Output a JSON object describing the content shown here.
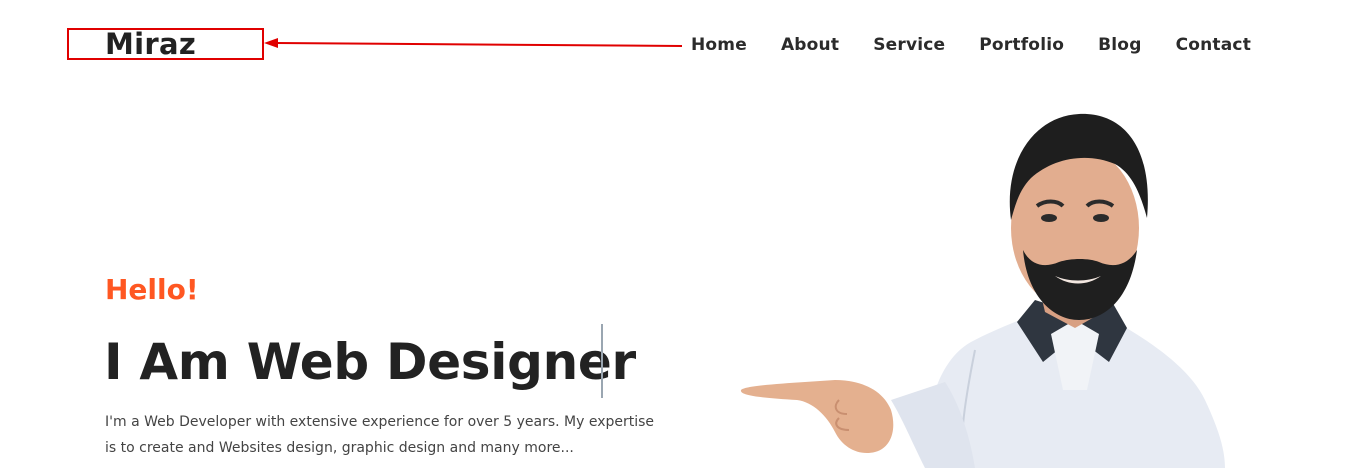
{
  "header": {
    "logo_text": "Miraz",
    "nav": [
      "Home",
      "About",
      "Service",
      "Portfolio",
      "Blog",
      "Contact"
    ]
  },
  "hero": {
    "greeting": "Hello!",
    "headline": "I Am Web Designer",
    "description": "I'm a Web Developer with extensive experience for over 5 years. My expertise is to create and Websites design, graphic design and many more..."
  },
  "annotation": {
    "color": "#e00000"
  },
  "colors": {
    "accent": "#ff5722",
    "text": "#222222"
  }
}
